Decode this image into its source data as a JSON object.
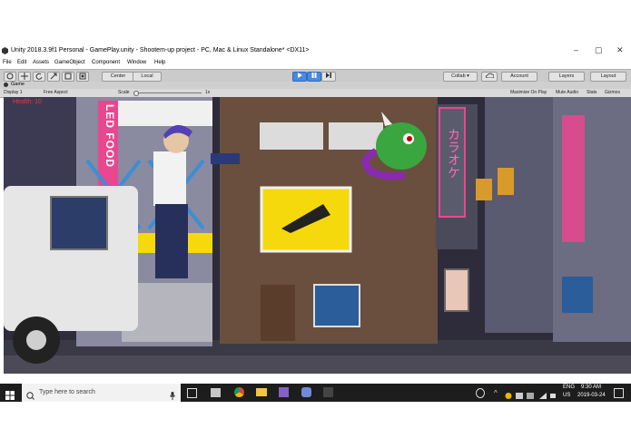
{
  "window": {
    "title": "Unity 2018.3.9f1 Personal - GamePlay.unity - Shootem-up project - PC, Mac & Linux Standalone* <DX11>",
    "minimize": "–",
    "maximize": "▢",
    "close": "✕"
  },
  "menu": [
    "File",
    "Edit",
    "Assets",
    "GameObject",
    "Component",
    "Window",
    "Help"
  ],
  "toolbar": {
    "pivot_center": "Center",
    "pivot_local": "Local",
    "collab": "Collab ▾",
    "account": "Account",
    "layers": "Layers",
    "layout": "Layout"
  },
  "game_tab": {
    "label": "Game"
  },
  "game_bar": {
    "display": "Display 1",
    "aspect": "Free Aspect",
    "scale_label": "Scale",
    "scale_value": "1x",
    "maximize_on_play": "Maximize On Play",
    "mute_audio": "Mute Audio",
    "stats": "Stats",
    "gizmos": "Gizmos"
  },
  "game": {
    "health": "Health: 10",
    "sign_led_food": "LED FOOD",
    "sign_karaoke": "カラオケ"
  },
  "taskbar": {
    "search_placeholder": "Type here to search",
    "lang_top": "ENG",
    "lang_bottom": "US",
    "time": "9:30 AM",
    "date": "2019-03-24"
  },
  "colors": {
    "toolbar_bg": "#cbcbcb",
    "play_active": "#4a89dc",
    "taskbar_bg": "#1d1d1d",
    "health_text": "#e83a3a",
    "sign_pink": "#e9478f",
    "billboard_yellow": "#f5d90c"
  }
}
